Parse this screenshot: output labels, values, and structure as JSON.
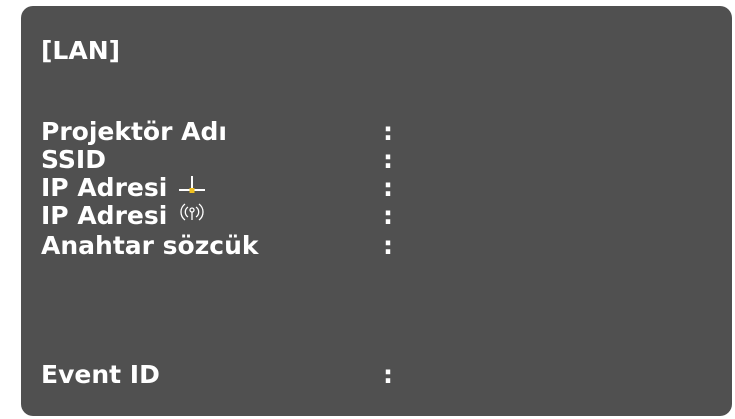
{
  "panel": {
    "title": "[LAN]"
  },
  "rows": [
    {
      "label": "Projektör Adı",
      "colon": ":",
      "value": ""
    },
    {
      "label": "SSID",
      "colon": ":",
      "value": ""
    },
    {
      "label": "IP Adresi",
      "icon": "wired-lan-icon",
      "colon": ":",
      "value": ""
    },
    {
      "label": "IP Adresi",
      "icon": "wireless-lan-icon",
      "colon": ":",
      "value": ""
    },
    {
      "label": "Anahtar sözcük",
      "colon": ":",
      "value": ""
    },
    {
      "label": "Event ID",
      "colon": ":",
      "value": ""
    }
  ],
  "colors": {
    "panel_background": "#505050",
    "text": "#ffffff",
    "wired_icon_accent": "#f0c020"
  }
}
